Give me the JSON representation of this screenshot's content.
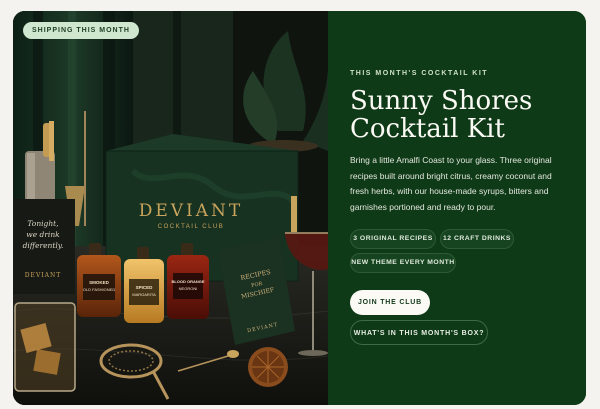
{
  "hero": {
    "badge": "SHIPPING THIS MONTH",
    "eyebrow": "THIS MONTH'S COCKTAIL KIT",
    "title_line1": "Sunny Shores",
    "title_line2": "Cocktail Kit",
    "description": "Bring a little Amalfi Coast to your glass. Three original recipes built around bright citrus, creamy coconut and fresh herbs, with our house-made syrups, bitters and garnishes portioned and ready to pour.",
    "chips": [
      "3 ORIGINAL RECIPES",
      "12 CRAFT DRINKS",
      "NEW THEME EVERY MONTH"
    ],
    "primary_button": "JOIN THE CLUB",
    "secondary_button": "WHAT'S IN THIS MONTH'S BOX?"
  },
  "photo": {
    "box_brand": "DEVIANT",
    "box_sub": "COCKTAIL CLUB",
    "card_left_line1": "Tonight,",
    "card_left_line2": "we drink",
    "card_left_line3": "differently.",
    "card_left_brand": "DEVIANT",
    "bottle1_line1": "SMOKED",
    "bottle1_line2": "OLD FASHIONED",
    "bottle2_line1": "SPICED",
    "bottle2_line2": "MARGARITA",
    "bottle3_line1": "BLOOD ORANGE",
    "bottle3_line2": "NEGRONI",
    "card_right_line1": "RECIPES",
    "card_right_line2": "FOR",
    "card_right_line3": "MISCHIEF",
    "card_right_brand": "DEVIANT"
  },
  "colors": {
    "panel": "#0f3a17",
    "accent_gold": "#c9a45c",
    "badge_bg": "#cfe7cf"
  }
}
